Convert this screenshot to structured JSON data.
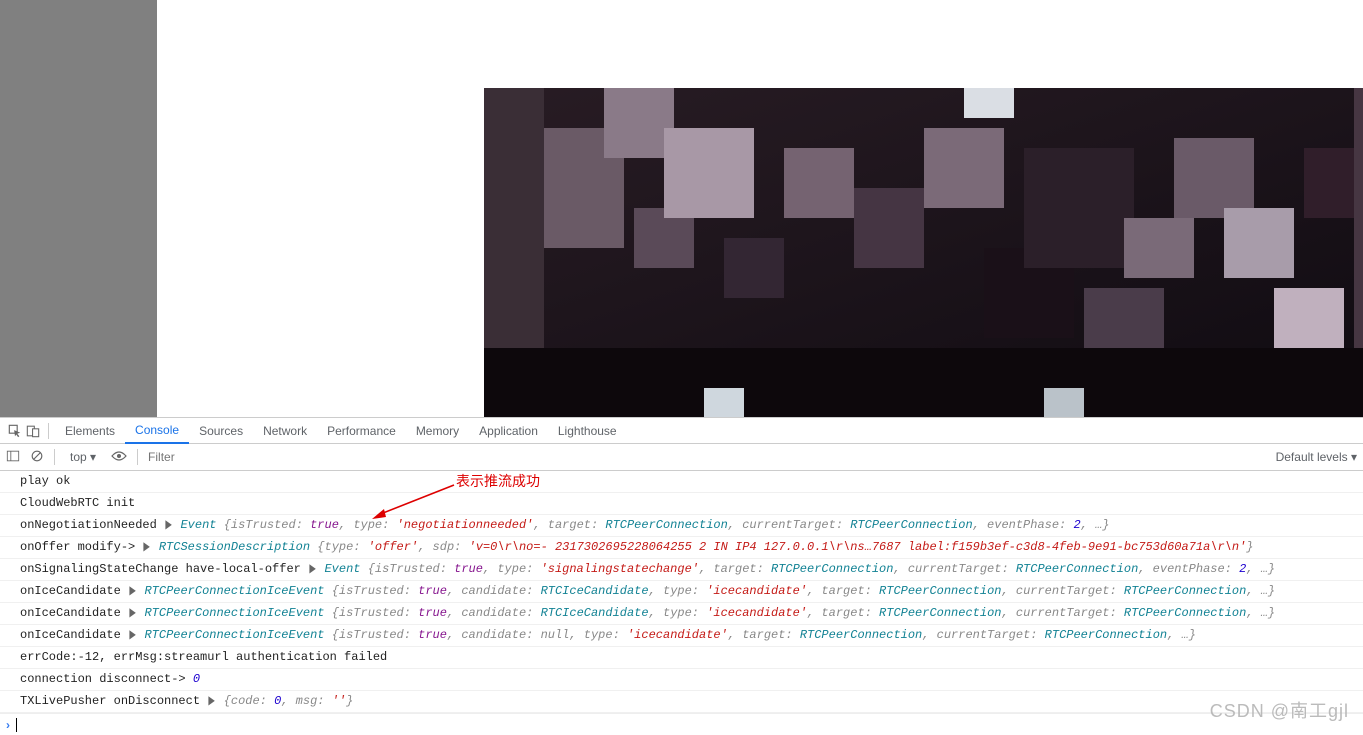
{
  "annotation": {
    "text": "表示推流成功"
  },
  "tabs": {
    "items": [
      "Elements",
      "Console",
      "Sources",
      "Network",
      "Performance",
      "Memory",
      "Application",
      "Lighthouse"
    ],
    "active": "Console"
  },
  "toolbar": {
    "context": "top ▾",
    "filter_placeholder": "Filter",
    "levels": "Default levels ▾"
  },
  "watermark": "CSDN @南工gjl",
  "console": [
    {
      "segments": [
        {
          "t": "play ok",
          "c": "k-black"
        }
      ]
    },
    {
      "segments": [
        {
          "t": "CloudWebRTC init",
          "c": "k-black"
        }
      ]
    },
    {
      "segments": [
        {
          "t": "onNegotiationNeeded ",
          "c": "k-black"
        },
        {
          "t": "▶",
          "c": "tri"
        },
        {
          "t": " Event ",
          "c": "k-teal italic"
        },
        {
          "t": "{isTrusted: ",
          "c": "k-gray"
        },
        {
          "t": "true",
          "c": "k-purple"
        },
        {
          "t": ", type: ",
          "c": "k-gray"
        },
        {
          "t": "'negotiationneeded'",
          "c": "k-red"
        },
        {
          "t": ", target: ",
          "c": "k-gray"
        },
        {
          "t": "RTCPeerConnection",
          "c": "k-teal"
        },
        {
          "t": ", currentTarget: ",
          "c": "k-gray"
        },
        {
          "t": "RTCPeerConnection",
          "c": "k-teal"
        },
        {
          "t": ", eventPhase: ",
          "c": "k-gray"
        },
        {
          "t": "2",
          "c": "k-num"
        },
        {
          "t": ", …}",
          "c": "k-gray"
        }
      ]
    },
    {
      "segments": [
        {
          "t": "onOffer modify-> ",
          "c": "k-black"
        },
        {
          "t": "▶",
          "c": "tri"
        },
        {
          "t": " RTCSessionDescription ",
          "c": "k-teal italic"
        },
        {
          "t": "{type: ",
          "c": "k-gray"
        },
        {
          "t": "'offer'",
          "c": "k-red"
        },
        {
          "t": ", sdp: ",
          "c": "k-gray"
        },
        {
          "t": "'v=0\\r\\no=- 2317302695228064255 2 IN IP4 127.0.0.1\\r\\ns…7687 label:f159b3ef-c3d8-4feb-9e91-bc753d60a71a\\r\\n'",
          "c": "k-red"
        },
        {
          "t": "}",
          "c": "k-gray"
        }
      ]
    },
    {
      "segments": [
        {
          "t": "onSignalingStateChange have-local-offer ",
          "c": "k-black"
        },
        {
          "t": "▶",
          "c": "tri"
        },
        {
          "t": " Event ",
          "c": "k-teal italic"
        },
        {
          "t": "{isTrusted: ",
          "c": "k-gray"
        },
        {
          "t": "true",
          "c": "k-purple"
        },
        {
          "t": ", type: ",
          "c": "k-gray"
        },
        {
          "t": "'signalingstatechange'",
          "c": "k-red"
        },
        {
          "t": ", target: ",
          "c": "k-gray"
        },
        {
          "t": "RTCPeerConnection",
          "c": "k-teal"
        },
        {
          "t": ", currentTarget: ",
          "c": "k-gray"
        },
        {
          "t": "RTCPeerConnection",
          "c": "k-teal"
        },
        {
          "t": ", eventPhase: ",
          "c": "k-gray"
        },
        {
          "t": "2",
          "c": "k-num"
        },
        {
          "t": ", …}",
          "c": "k-gray"
        }
      ]
    },
    {
      "segments": [
        {
          "t": "onIceCandidate ",
          "c": "k-black"
        },
        {
          "t": "▶",
          "c": "tri"
        },
        {
          "t": " RTCPeerConnectionIceEvent ",
          "c": "k-teal italic"
        },
        {
          "t": "{isTrusted: ",
          "c": "k-gray"
        },
        {
          "t": "true",
          "c": "k-purple"
        },
        {
          "t": ", candidate: ",
          "c": "k-gray"
        },
        {
          "t": "RTCIceCandidate",
          "c": "k-teal"
        },
        {
          "t": ", type: ",
          "c": "k-gray"
        },
        {
          "t": "'icecandidate'",
          "c": "k-red"
        },
        {
          "t": ", target: ",
          "c": "k-gray"
        },
        {
          "t": "RTCPeerConnection",
          "c": "k-teal"
        },
        {
          "t": ", currentTarget: ",
          "c": "k-gray"
        },
        {
          "t": "RTCPeerConnection",
          "c": "k-teal"
        },
        {
          "t": ", …}",
          "c": "k-gray"
        }
      ]
    },
    {
      "segments": [
        {
          "t": "onIceCandidate ",
          "c": "k-black"
        },
        {
          "t": "▶",
          "c": "tri"
        },
        {
          "t": " RTCPeerConnectionIceEvent ",
          "c": "k-teal italic"
        },
        {
          "t": "{isTrusted: ",
          "c": "k-gray"
        },
        {
          "t": "true",
          "c": "k-purple"
        },
        {
          "t": ", candidate: ",
          "c": "k-gray"
        },
        {
          "t": "RTCIceCandidate",
          "c": "k-teal"
        },
        {
          "t": ", type: ",
          "c": "k-gray"
        },
        {
          "t": "'icecandidate'",
          "c": "k-red"
        },
        {
          "t": ", target: ",
          "c": "k-gray"
        },
        {
          "t": "RTCPeerConnection",
          "c": "k-teal"
        },
        {
          "t": ", currentTarget: ",
          "c": "k-gray"
        },
        {
          "t": "RTCPeerConnection",
          "c": "k-teal"
        },
        {
          "t": ", …}",
          "c": "k-gray"
        }
      ]
    },
    {
      "segments": [
        {
          "t": "onIceCandidate ",
          "c": "k-black"
        },
        {
          "t": "▶",
          "c": "tri"
        },
        {
          "t": " RTCPeerConnectionIceEvent ",
          "c": "k-teal italic"
        },
        {
          "t": "{isTrusted: ",
          "c": "k-gray"
        },
        {
          "t": "true",
          "c": "k-purple"
        },
        {
          "t": ", candidate: ",
          "c": "k-gray"
        },
        {
          "t": "null",
          "c": "k-gray"
        },
        {
          "t": ", type: ",
          "c": "k-gray"
        },
        {
          "t": "'icecandidate'",
          "c": "k-red"
        },
        {
          "t": ", target: ",
          "c": "k-gray"
        },
        {
          "t": "RTCPeerConnection",
          "c": "k-teal"
        },
        {
          "t": ", currentTarget: ",
          "c": "k-gray"
        },
        {
          "t": "RTCPeerConnection",
          "c": "k-teal"
        },
        {
          "t": ", …}",
          "c": "k-gray"
        }
      ]
    },
    {
      "segments": [
        {
          "t": "errCode:-12, errMsg:streamurl authentication failed",
          "c": "k-black"
        }
      ]
    },
    {
      "segments": [
        {
          "t": "connection disconnect-> ",
          "c": "k-black"
        },
        {
          "t": "0",
          "c": "k-num"
        }
      ]
    },
    {
      "segments": [
        {
          "t": "TXLivePusher onDisconnect ",
          "c": "k-black"
        },
        {
          "t": "▶",
          "c": "tri"
        },
        {
          "t": " {code: ",
          "c": "k-gray"
        },
        {
          "t": "0",
          "c": "k-num"
        },
        {
          "t": ", msg: ",
          "c": "k-gray"
        },
        {
          "t": "''",
          "c": "k-red"
        },
        {
          "t": "}",
          "c": "k-gray"
        }
      ]
    }
  ]
}
